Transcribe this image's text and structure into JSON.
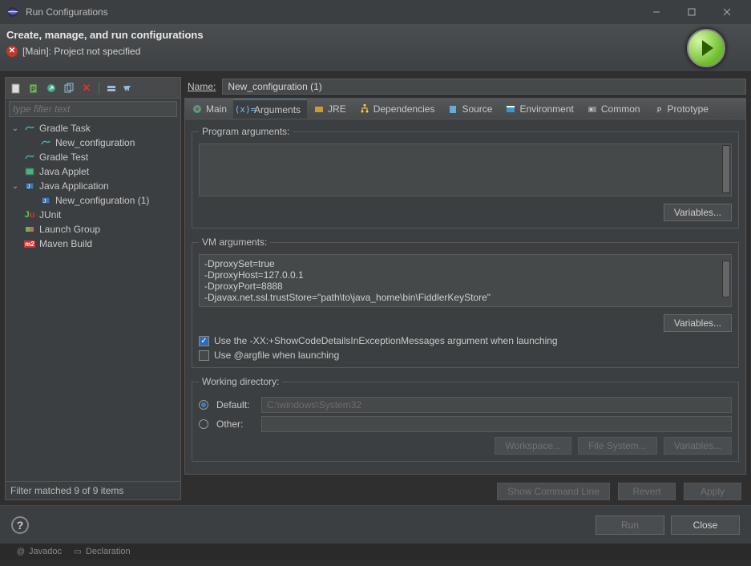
{
  "window": {
    "title": "Run Configurations"
  },
  "header": {
    "title": "Create, manage, and run configurations",
    "error_msg": "[Main]: Project not specified"
  },
  "filter_placeholder": "type filter text",
  "tree": [
    {
      "type": "group",
      "expanded": true,
      "icon": "gradle",
      "label": "Gradle Task",
      "children": [
        {
          "icon": "gradle",
          "label": "New_configuration"
        }
      ]
    },
    {
      "type": "item",
      "icon": "gradle",
      "label": "Gradle Test"
    },
    {
      "type": "item",
      "icon": "applet",
      "label": "Java Applet"
    },
    {
      "type": "group",
      "expanded": true,
      "icon": "java",
      "label": "Java Application",
      "children": [
        {
          "icon": "java",
          "label": "New_configuration (1)"
        }
      ]
    },
    {
      "type": "item",
      "icon": "junit",
      "label": "JUnit"
    },
    {
      "type": "item",
      "icon": "launchgroup",
      "label": "Launch Group"
    },
    {
      "type": "item",
      "icon": "maven",
      "label": "Maven Build"
    }
  ],
  "tree_status": "Filter matched 9 of 9 items",
  "name": {
    "label": "Name:",
    "value": "New_configuration (1)"
  },
  "tabs": [
    {
      "id": "main",
      "label": "Main"
    },
    {
      "id": "arguments",
      "label": "Arguments",
      "active": true
    },
    {
      "id": "jre",
      "label": "JRE"
    },
    {
      "id": "dependencies",
      "label": "Dependencies"
    },
    {
      "id": "source",
      "label": "Source"
    },
    {
      "id": "environment",
      "label": "Environment"
    },
    {
      "id": "common",
      "label": "Common"
    },
    {
      "id": "prototype",
      "label": "Prototype"
    }
  ],
  "program_args": {
    "legend": "Program arguments:",
    "value": "",
    "variables_btn": "Variables..."
  },
  "vm_args": {
    "legend": "VM arguments:",
    "value": "-DproxySet=true\n-DproxyHost=127.0.0.1\n-DproxyPort=8888\n-Djavax.net.ssl.trustStore=\"path\\to\\java_home\\bin\\FiddlerKeyStore\"",
    "variables_btn": "Variables...",
    "chk_showcode": {
      "checked": true,
      "label": "Use the -XX:+ShowCodeDetailsInExceptionMessages argument when launching"
    },
    "chk_argfile": {
      "checked": false,
      "label": "Use @argfile when launching"
    }
  },
  "working_dir": {
    "legend": "Working directory:",
    "default_label": "Default:",
    "default_value": "C:\\windows\\System32",
    "other_label": "Other:",
    "btn_workspace": "Workspace...",
    "btn_filesystem": "File System...",
    "btn_variables": "Variables..."
  },
  "actions": {
    "show_cmd": "Show Command Line",
    "revert": "Revert",
    "apply": "Apply",
    "run": "Run",
    "close": "Close"
  },
  "bottom_strip": {
    "javadoc": "Javadoc",
    "declaration": "Declaration"
  }
}
